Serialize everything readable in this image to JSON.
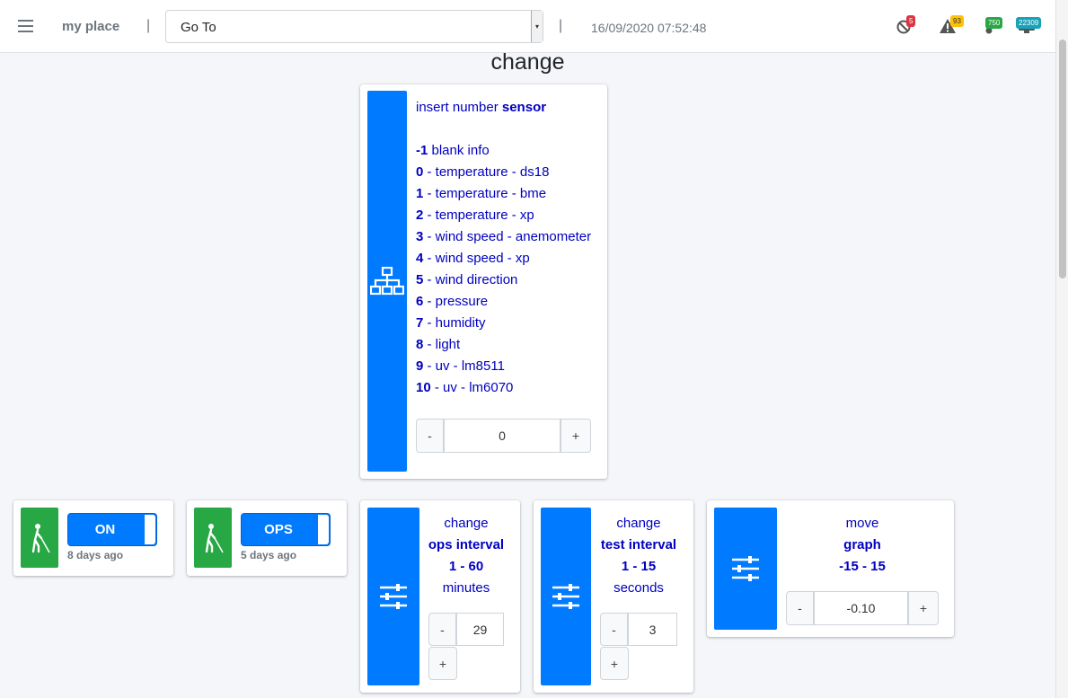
{
  "navbar": {
    "brand": "my place",
    "separator": "|",
    "goto_value": "Go To",
    "datetime": "16/09/2020 07:52:48",
    "indicators": [
      {
        "icon": "ban-icon",
        "count": "5",
        "color": "#dc3545"
      },
      {
        "icon": "warning-icon",
        "count": "93",
        "color": "#ffc107"
      },
      {
        "icon": "thermometer-icon",
        "count": "750",
        "color": "#28a745"
      },
      {
        "icon": "monitor-icon",
        "count": "22309",
        "color": "#17a2b8"
      }
    ]
  },
  "page_title": "change",
  "sensor_card": {
    "icon": "network-icon",
    "prompt": "insert number ",
    "prompt_bold": "sensor",
    "options": [
      {
        "num": "-1",
        "label": " blank info"
      },
      {
        "num": "0",
        "label": " - temperature - ds18"
      },
      {
        "num": "1",
        "label": " - temperature - bme"
      },
      {
        "num": "2",
        "label": " - temperature - xp"
      },
      {
        "num": "3",
        "label": " - wind speed - anemometer"
      },
      {
        "num": "4",
        "label": " - wind speed - xp"
      },
      {
        "num": "5",
        "label": " - wind direction"
      },
      {
        "num": "6",
        "label": " - pressure"
      },
      {
        "num": "7",
        "label": " - humidity"
      },
      {
        "num": "8",
        "label": " - light"
      },
      {
        "num": "9",
        "label": " - uv - lm8511"
      },
      {
        "num": "10",
        "label": " - uv - lm6070"
      }
    ],
    "minus": "-",
    "value": "0",
    "plus": "+"
  },
  "switches": [
    {
      "icon": "blind-person-icon",
      "state": "ON",
      "ago": "8 days ago"
    },
    {
      "icon": "blind-person-icon",
      "state": "OPS",
      "ago": "5 days ago"
    }
  ],
  "settings": [
    {
      "icon": "sliders-icon",
      "line1": "change",
      "line2": "ops interval",
      "line3": "1 - 60",
      "line4": "minutes",
      "value": "29",
      "minus": "-",
      "plus": "+"
    },
    {
      "icon": "sliders-icon",
      "line1": "change",
      "line2": "test interval",
      "line3": "1 - 15",
      "line4": "seconds",
      "value": "3",
      "minus": "-",
      "plus": "+"
    },
    {
      "icon": "sliders-icon",
      "line1": "move",
      "line2": "graph",
      "line3": "-15 - 15",
      "value": "-0.10",
      "minus": "-",
      "plus": "+"
    }
  ],
  "colors": {
    "primary": "#007bff",
    "success": "#28a745",
    "text_blue": "#0000c0"
  }
}
